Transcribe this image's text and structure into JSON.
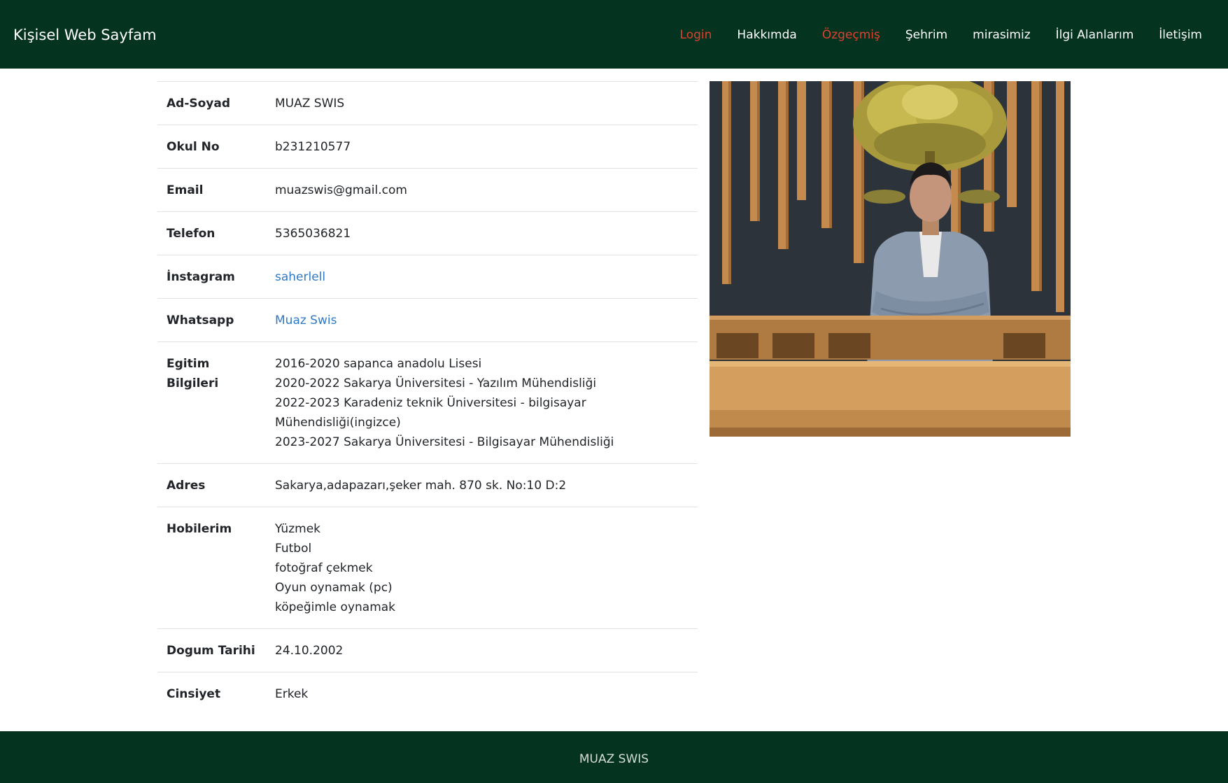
{
  "brand": "Kişisel Web Sayfam",
  "nav": [
    {
      "label": "Login",
      "active": true
    },
    {
      "label": "Hakkımda",
      "active": false
    },
    {
      "label": "Özgeçmiş",
      "active": true
    },
    {
      "label": "Şehrim",
      "active": false
    },
    {
      "label": "mirasimiz",
      "active": false
    },
    {
      "label": "İlgi Alanlarım",
      "active": false
    },
    {
      "label": "İletişim",
      "active": false
    }
  ],
  "profile": {
    "name_label": "Ad-Soyad",
    "name": "MUAZ SWIS",
    "school_no_label": "Okul No",
    "school_no": "b231210577",
    "email_label": "Email",
    "email": "muazswis@gmail.com",
    "phone_label": "Telefon",
    "phone": "5365036821",
    "instagram_label": "İnstagram",
    "instagram": "saherlell",
    "whatsapp_label": "Whatsapp",
    "whatsapp": "Muaz Swis",
    "education_label_line1": "Egitim",
    "education_label_line2": "Bilgileri",
    "education": [
      "2016-2020 sapanca anadolu Lisesi",
      "2020-2022 Sakarya Üniversitesi - Yazılım Mühendisliği",
      "2022-2023 Karadeniz teknik Üniversitesi - bilgisayar",
      "Mühendisliği(ingizce)",
      "2023-2027 Sakarya Üniversitesi - Bilgisayar Mühendisliği"
    ],
    "address_label": "Adres",
    "address": "Sakarya,adapazarı,şeker mah. 870 sk. No:10 D:2",
    "hobbies_label": "Hobilerim",
    "hobbies": [
      "Yüzmek",
      "Futbol",
      "fotoğraf çekmek",
      "Oyun oynamak (pc)",
      "köpeğimle oynamak"
    ],
    "birthdate_label": "Dogum Tarihi",
    "birthdate": "24.10.2002",
    "gender_label": "Cinsiyet",
    "gender": "Erkek"
  },
  "photo": {
    "alt": "profile-photo"
  },
  "footer": {
    "text": "MUAZ SWIS"
  },
  "colors": {
    "nav_bg": "#04331f",
    "active_link": "#e0412f",
    "link": "#2f79c6"
  }
}
